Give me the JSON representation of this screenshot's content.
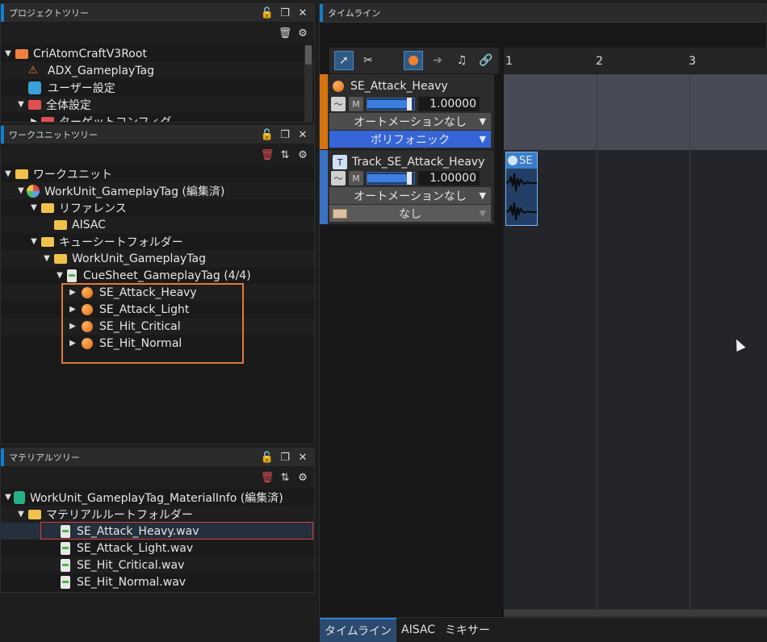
{
  "project_tree": {
    "title": "プロジェクトツリー",
    "items": [
      {
        "label": "CriAtomCraftV3Root"
      },
      {
        "label": "ADX_GameplayTag"
      },
      {
        "label": "ユーザー設定"
      },
      {
        "label": "全体設定"
      },
      {
        "label": "ターゲットコンフィグ"
      }
    ]
  },
  "workunit_tree": {
    "title": "ワークユニットツリー",
    "items": [
      {
        "label": "ワークユニット"
      },
      {
        "label": "WorkUnit_GameplayTag (編集済)"
      },
      {
        "label": "リファレンス"
      },
      {
        "label": "AISAC"
      },
      {
        "label": "キューシートフォルダー"
      },
      {
        "label": "WorkUnit_GameplayTag"
      },
      {
        "label": "CueSheet_GameplayTag (4/4)"
      },
      {
        "label": "SE_Attack_Heavy"
      },
      {
        "label": "SE_Attack_Light"
      },
      {
        "label": "SE_Hit_Critical"
      },
      {
        "label": "SE_Hit_Normal"
      }
    ]
  },
  "material_tree": {
    "title": "マテリアルツリー",
    "items": [
      {
        "label": "WorkUnit_GameplayTag_MaterialInfo (編集済)"
      },
      {
        "label": "マテリアルルートフォルダー"
      },
      {
        "label": "SE_Attack_Heavy.wav"
      },
      {
        "label": "SE_Attack_Light.wav"
      },
      {
        "label": "SE_Hit_Critical.wav"
      },
      {
        "label": "SE_Hit_Normal.wav"
      }
    ]
  },
  "timeline": {
    "title": "タイムライン",
    "ruler": [
      "1",
      "2",
      "3"
    ],
    "cue": {
      "name": "SE_Attack_Heavy",
      "mute": "M",
      "volume": "1.00000",
      "volume_level": 0.85,
      "automation": "オートメーションなし",
      "mode": "ポリフォニック"
    },
    "track": {
      "name": "Track_SE_Attack_Heavy",
      "mute": "M",
      "volume": "1.00000",
      "volume_level": 0.85,
      "automation": "オートメーションなし",
      "option": "なし"
    },
    "waveform_label": "SE"
  },
  "bottom_tabs": [
    "タイムライン",
    "AISAC",
    "ミキサー"
  ],
  "colors": {
    "accent": "#0f7fd0",
    "highlight": "#e07a3a",
    "selection": "#e03a3a"
  }
}
